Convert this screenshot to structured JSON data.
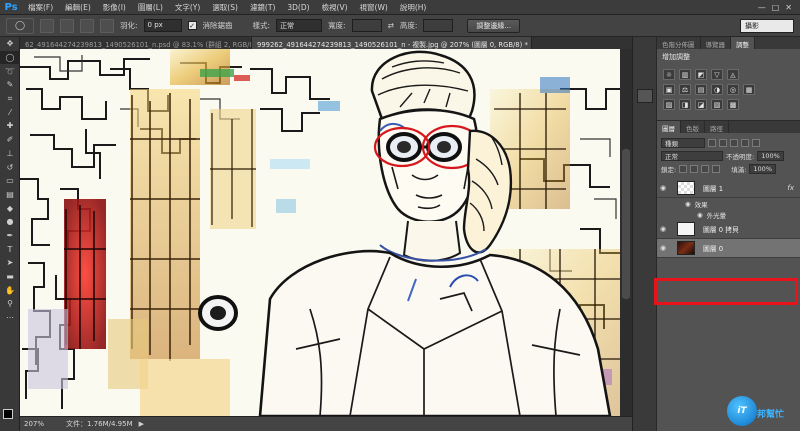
{
  "app": {
    "logo": "Ps"
  },
  "menu": [
    "檔案(F)",
    "編輯(E)",
    "影像(I)",
    "圖層(L)",
    "文字(Y)",
    "選取(S)",
    "濾鏡(T)",
    "3D(D)",
    "檢視(V)",
    "視窗(W)",
    "說明(H)"
  ],
  "window_controls": [
    "—",
    "□",
    "✕"
  ],
  "options": {
    "feather_label": "羽化:",
    "feather_value": "0 px",
    "antialias_label": "消除鋸齒",
    "style_label": "樣式:",
    "style_value": "正常",
    "width_label": "寬度:",
    "height_label": "高度:",
    "refine_button": "調整邊緣...",
    "workspace": "攝影"
  },
  "tabs": [
    {
      "label": "62_491644274239813_1490526101_n.psd @ 83.1% (群組 2, RGB/8) *",
      "active": false
    },
    {
      "label": "999262_491644274239813_1490526101_n - 複製.jpg @ 207% (圖層 0, RGB/8) *",
      "active": true
    }
  ],
  "status": {
    "zoom": "207%",
    "doc_size": "文件：1.76M/4.95M",
    "arrow": "▶"
  },
  "adjustments": {
    "tabs": [
      "色階分佈圖",
      "導覽器",
      "調整"
    ],
    "active_tab": "調整",
    "title": "增加調整",
    "row1": [
      "☼",
      "▥",
      "◩",
      "▽",
      "◬"
    ],
    "row2": [
      "▣",
      "⚖",
      "▤",
      "◑",
      "◎",
      "▦"
    ],
    "row3": [
      "▨",
      "◨",
      "◪",
      "▧",
      "▩"
    ]
  },
  "layers": {
    "tabs": [
      "圖層",
      "色版",
      "路徑"
    ],
    "active_tab": "圖層",
    "filter_value": "種類",
    "blend_mode": "正常",
    "opacity_label": "不透明度:",
    "opacity_value": "100%",
    "lock_label": "鎖定:",
    "fill_label": "填滿:",
    "fill_value": "100%",
    "items": [
      {
        "name": "圖層 1",
        "thumb": "checker",
        "fx": "fx"
      },
      {
        "name": "效果"
      },
      {
        "name": "外光暈"
      },
      {
        "name": "圖層 0 拷貝",
        "thumb": "light"
      },
      {
        "name": "圖層 0",
        "thumb": "dark"
      }
    ]
  },
  "watermark": {
    "circle": "iT",
    "text": "邦幫忙"
  }
}
